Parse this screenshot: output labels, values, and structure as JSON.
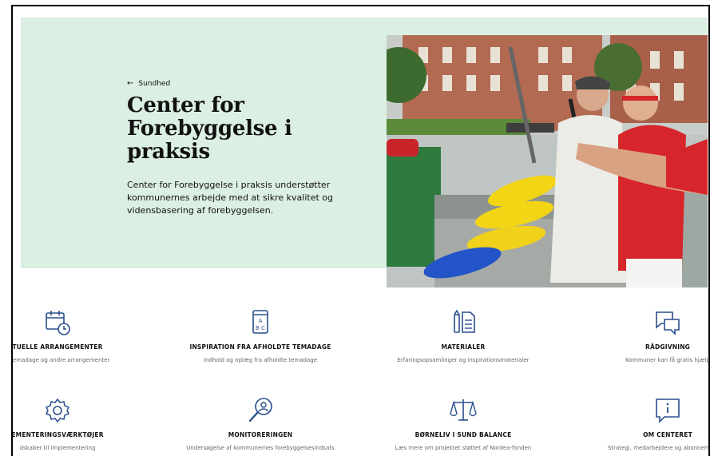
{
  "breadcrumb": {
    "arrow": "←",
    "label": "Sundhed"
  },
  "hero": {
    "title": "Center for\nForebyggelse i\npraksis",
    "description": "Center for Forebyggelse i praksis understøtter kommunernes arbejde med at sikre kvalitet og vidensbasering af forebyggelsen.",
    "photo_alt": "Ældre mænd der spiller floorball"
  },
  "tiles": [
    {
      "icon": "calendar-clock-icon",
      "title": "TUELLE ARRANGEMENTER",
      "subtitle": "e temadage og andre arrangementer"
    },
    {
      "icon": "abc-book-icon",
      "title": "INSPIRATION FRA AFHOLDTE TEMADAGE",
      "subtitle": "Indhold og oplæg fra afholdte temadage"
    },
    {
      "icon": "documents-icon",
      "title": "MATERIALER",
      "subtitle": "Erfaringsopsamlinger og inspirationsmaterialer"
    },
    {
      "icon": "chat-bubbles-icon",
      "title": "RÅDGIVNING",
      "subtitle": "Kommuner kan få gratis hjælp"
    },
    {
      "icon": "gear-icon",
      "title": "EMENTERINGSVÆRKTØJER",
      "subtitle": "dskaber til implementering"
    },
    {
      "icon": "magnifier-person-icon",
      "title": "MONITORERINGEN",
      "subtitle": "Undersøgelse af kommunernes forebyggelsesindsats"
    },
    {
      "icon": "balance-scale-icon",
      "title": "BØRNELIV I SUND BALANCE",
      "subtitle": "Læs mere om projektet støttet af Nordea-fonden"
    },
    {
      "icon": "info-bubble-icon",
      "title": "OM CENTERET",
      "subtitle": "Strategi, medarbejdere og abonnement på"
    }
  ],
  "colors": {
    "hero_bg": "#dcefe3",
    "icon_blue": "#2a4f8c",
    "text": "#111111"
  }
}
